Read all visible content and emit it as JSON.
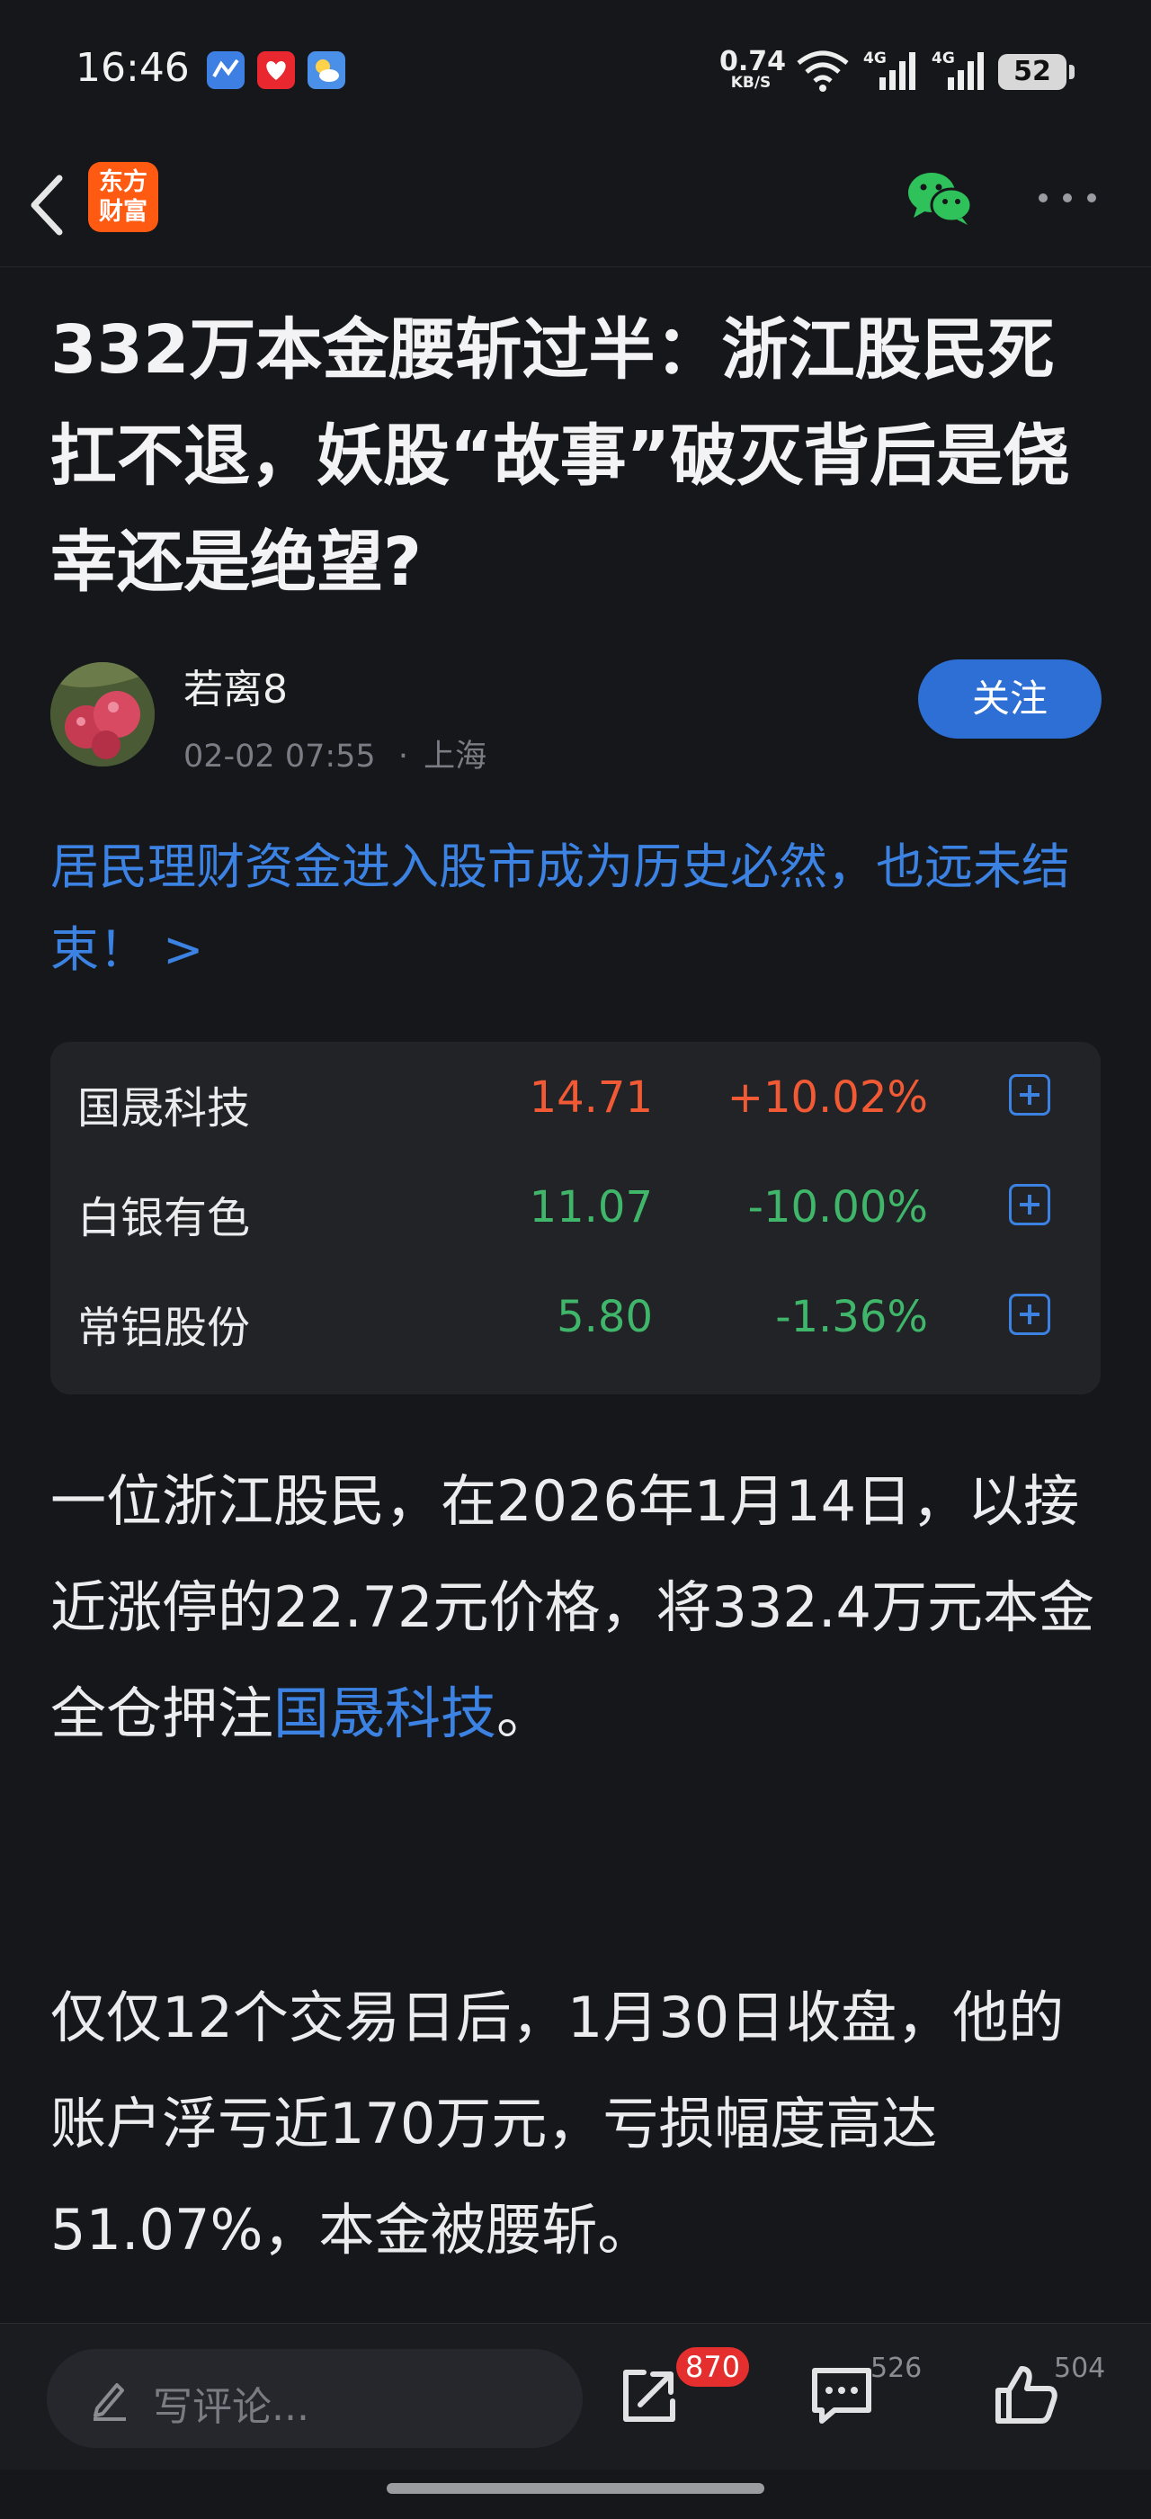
{
  "status_bar": {
    "time": "16:46",
    "net_speed_value": "0.74",
    "net_speed_unit": "KB/S",
    "signal_1": "4G",
    "signal_2": "4G",
    "battery": "52",
    "app_icons": [
      "maps-app-icon",
      "health-app-icon",
      "weather-app-icon"
    ]
  },
  "nav": {
    "logo_line1": "东方",
    "logo_line2": "财富",
    "icons": [
      "back-chevron-icon",
      "wechat-share-icon",
      "more-dots-icon"
    ]
  },
  "article": {
    "title": "332万本金腰斩过半：浙江股民死扛不退，妖股“故事”破灭背后是侥幸还是绝望?",
    "author": "若离8",
    "date": "02-02 07:55",
    "location": "上海",
    "location_separator": "·",
    "follow_label": "关注",
    "topic_link": "居民理财资金进入股市成为历史必然，也远未结束！ >",
    "paragraph1_before": "一位浙江股民，在2026年1月14日，以接近涨停的22.72元价格，将332.4万元本金全仓押注",
    "paragraph1_link": "国晟科技",
    "paragraph1_after": "。",
    "paragraph2": "仅仅12个交易日后，1月30日收盘，他的账户浮亏近170万元，亏损幅度高达51.07%，本金被腰斩。"
  },
  "stocks": [
    {
      "name": "国晟科技",
      "price": "14.71",
      "change": "+10.02%",
      "direction": "up"
    },
    {
      "name": "白银有色",
      "price": "11.07",
      "change": "-10.00%",
      "direction": "down"
    },
    {
      "name": "常铝股份",
      "price": "5.80",
      "change": "-1.36%",
      "direction": "down"
    }
  ],
  "bottom_bar": {
    "comment_placeholder": "写评论...",
    "share_badge": "870",
    "comment_count": "526",
    "like_count": "504"
  },
  "colors": {
    "background": "#16171b",
    "accent_blue": "#3b82e2",
    "follow_button": "#2d6fd4",
    "up_red": "#f15a35",
    "down_green": "#3fb66a",
    "brand_orange": "#ff5a12"
  }
}
